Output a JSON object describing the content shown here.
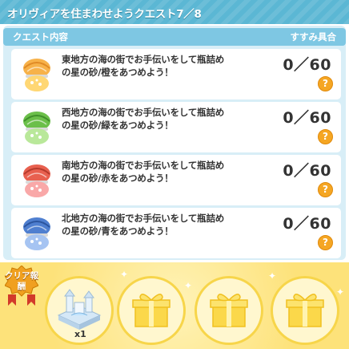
{
  "title": "オリヴィアを住まわせようクエスト7／8",
  "quest_header": {
    "left_label": "クエスト内容",
    "right_label": "すすみ具合"
  },
  "quests": [
    {
      "description": "東地方の海の街でお手伝いをして瓶詰めの星の砂/橙をあつめよう！",
      "progress": "0／60",
      "help": "?",
      "jar_color": "#f7b24a"
    },
    {
      "description": "西地方の海の街でお手伝いをして瓶詰めの星の砂/緑をあつめよう！",
      "progress": "0／60",
      "help": "?",
      "jar_color": "#8ccf6b"
    },
    {
      "description": "南地方の海の街でお手伝いをして瓶詰めの星の砂/赤をあつめよう！",
      "progress": "0／60",
      "help": "?",
      "jar_color": "#f07f7f"
    },
    {
      "description": "北地方の海の街でお手伝いをして瓶詰めの星の砂/青をあつめよう！",
      "progress": "0／60",
      "help": "?",
      "jar_color": "#6f9fe0"
    }
  ],
  "reward": {
    "badge_label": "クリア報酬",
    "item_count": "x1"
  },
  "colors": {
    "title_bar": "#5bb7d4",
    "panel_bg": "#d8eef7",
    "header_bg": "#7ec7e3",
    "reward_bg": "#fde27a",
    "help_button": "#f5a623"
  }
}
